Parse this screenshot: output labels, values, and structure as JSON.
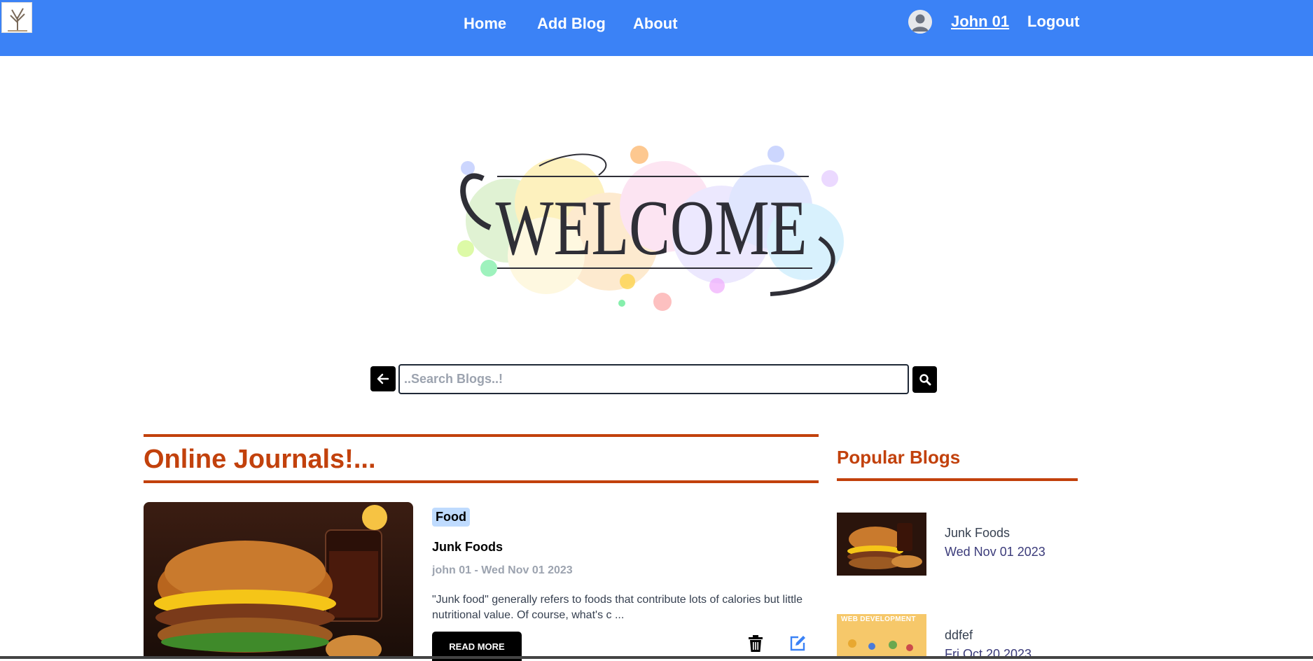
{
  "nav": {
    "links": [
      "Home",
      "Add Blog",
      "About"
    ],
    "user": "John 01",
    "logout": "Logout"
  },
  "hero": {
    "text": "WELCOME"
  },
  "search": {
    "placeholder": "..Search Blogs..!"
  },
  "main": {
    "heading": "Online Journals!...",
    "post": {
      "category": "Food",
      "title": "Junk Foods",
      "meta": "john 01 - Wed Nov 01 2023",
      "excerpt": "\"Junk food\" generally refers to foods that contribute lots of calories but little nutritional value. Of course, what's c ...",
      "read_more": "READ MORE"
    }
  },
  "sidebar": {
    "heading": "Popular Blogs",
    "items": [
      {
        "title": "Junk Foods",
        "date": "Wed Nov 01 2023",
        "thumb_text": ""
      },
      {
        "title": "ddfef",
        "date": "Fri Oct 20 2023",
        "thumb_text": "WEB DEVELOPMENT"
      }
    ]
  },
  "colors": {
    "nav_bg": "#3b82f6",
    "accent": "#c2410c",
    "badge_bg": "#bfdbfe"
  }
}
